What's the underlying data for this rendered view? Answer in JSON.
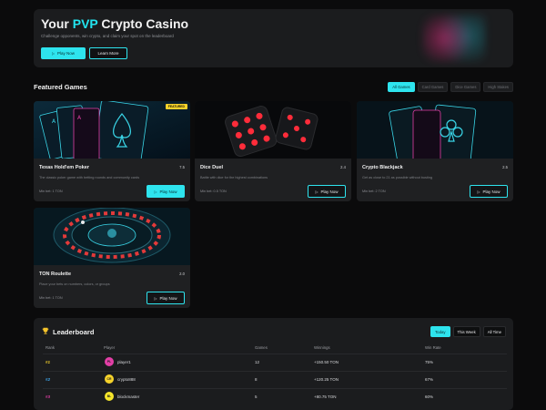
{
  "hero": {
    "title_prefix": "Your ",
    "title_highlight": "PVP",
    "title_suffix": " Crypto Casino",
    "subtitle": "Challenge opponents, win crypto, and claim your spot on the leaderboard",
    "play_now": "Play Now",
    "learn_more": "Learn More"
  },
  "featured": {
    "title": "Featured Games",
    "filters": [
      "All Games",
      "Card Games",
      "Dice Games",
      "High Stakes"
    ],
    "active_filter": "All Games"
  },
  "games": [
    {
      "name": "Texas Hold'em Poker",
      "count": "7.5",
      "desc": "The classic poker game with betting rounds and community cards",
      "bet": "Min bet: 1 TON",
      "badge": "FEATURED",
      "play": "Play Now",
      "art": "poker-cards"
    },
    {
      "name": "Dice Duel",
      "count": "2.4",
      "desc": "Battle with dice for the highest combinations",
      "bet": "Min bet: 0.5 TON",
      "play": "Play Now",
      "art": "red-dice"
    },
    {
      "name": "Crypto Blackjack",
      "count": "2.5",
      "desc": "Get as close to 21 as possible without busting",
      "bet": "Min bet: 2 TON",
      "play": "Play Now",
      "art": "blackjack-cards"
    },
    {
      "name": "TON Roulette",
      "count": "2.0",
      "desc": "Place your bets on numbers, colors, or groups",
      "bet": "Min bet: 1 TON",
      "play": "Play Now",
      "art": "roulette-wheel"
    }
  ],
  "leaderboard": {
    "title": "Leaderboard",
    "tabs": [
      "Today",
      "This Week",
      "All Time"
    ],
    "active_tab": "Today",
    "headers": {
      "rank": "Rank",
      "player": "Player",
      "games": "Games",
      "winnings": "Winnings",
      "win_rate": "Win Rate"
    },
    "rows": [
      {
        "rank": "#1",
        "rank_color": "#f5d22b",
        "initials": "PL",
        "avatar_color": "#e23fa6",
        "player": "player1",
        "games": "12",
        "winnings": "+150.50 TON",
        "win_rate": "75%"
      },
      {
        "rank": "#2",
        "rank_color": "#3fa9ee",
        "initials": "CR",
        "avatar_color": "#f5d22b",
        "player": "crypto888",
        "games": "8",
        "winnings": "+120.25 TON",
        "win_rate": "67%"
      },
      {
        "rank": "#3",
        "rank_color": "#e23fa6",
        "initials": "BL",
        "avatar_color": "#f5e52b",
        "player": "blockmaster",
        "games": "5",
        "winnings": "+80.75 TON",
        "win_rate": "60%"
      }
    ]
  },
  "colors": {
    "accent": "#2ee4ee",
    "badge": "#f5d22b",
    "card_bg": "#1f2022",
    "page_bg": "#0b0b0c"
  }
}
